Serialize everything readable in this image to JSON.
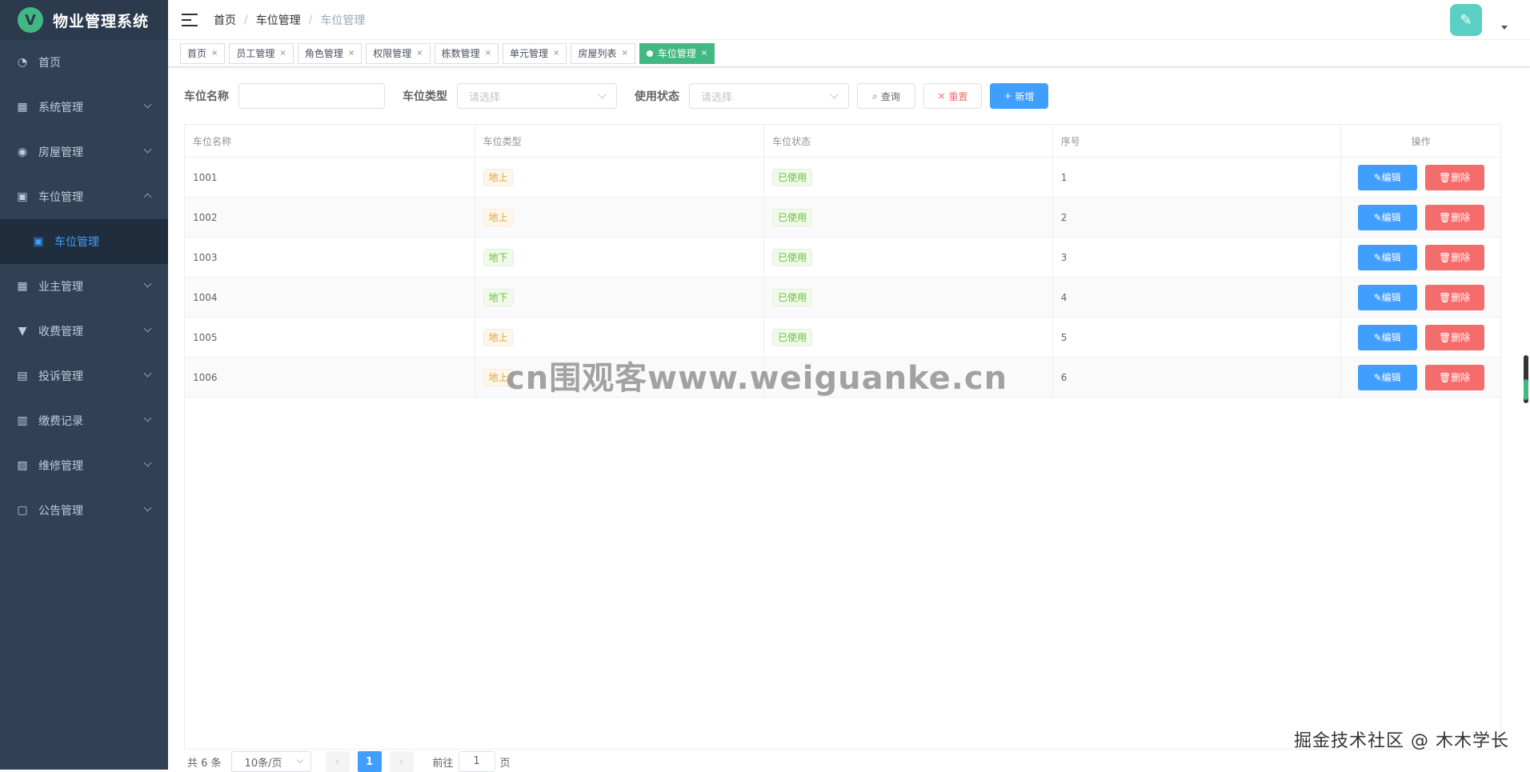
{
  "app": {
    "title": "物业管理系统",
    "logo_letter": "V"
  },
  "sidebar": {
    "items": [
      {
        "label": "首页",
        "icon": "dashboard-icon"
      },
      {
        "label": "系统管理",
        "icon": "grid-icon"
      },
      {
        "label": "房屋管理",
        "icon": "house-icon"
      },
      {
        "label": "车位管理",
        "icon": "parking-icon",
        "expanded": true,
        "children": [
          {
            "label": "车位管理",
            "icon": "parking-icon",
            "active": true
          }
        ]
      },
      {
        "label": "业主管理",
        "icon": "table-icon"
      },
      {
        "label": "收费管理",
        "icon": "payment-icon"
      },
      {
        "label": "投诉管理",
        "icon": "calendar-icon"
      },
      {
        "label": "缴费记录",
        "icon": "barcode-icon"
      },
      {
        "label": "维修管理",
        "icon": "image-icon"
      },
      {
        "label": "公告管理",
        "icon": "document-icon"
      }
    ]
  },
  "breadcrumb": [
    "首页",
    "车位管理",
    "车位管理"
  ],
  "tags": [
    {
      "label": "首页",
      "active": false
    },
    {
      "label": "员工管理",
      "active": false
    },
    {
      "label": "角色管理",
      "active": false
    },
    {
      "label": "权限管理",
      "active": false
    },
    {
      "label": "栋数管理",
      "active": false
    },
    {
      "label": "单元管理",
      "active": false
    },
    {
      "label": "房屋列表",
      "active": false
    },
    {
      "label": "车位管理",
      "active": true
    }
  ],
  "search": {
    "name_label": "车位名称",
    "name_value": "",
    "type_label": "车位类型",
    "type_placeholder": "请选择",
    "status_label": "使用状态",
    "status_placeholder": "请选择",
    "query_label": "查询",
    "reset_label": "重置",
    "add_label": "新增"
  },
  "table": {
    "columns": [
      "车位名称",
      "车位类型",
      "车位状态",
      "序号",
      "操作"
    ],
    "rows": [
      {
        "name": "1001",
        "type": "地上",
        "type_style": "warn",
        "status": "已使用",
        "order": "1"
      },
      {
        "name": "1002",
        "type": "地上",
        "type_style": "warn",
        "status": "已使用",
        "order": "2"
      },
      {
        "name": "1003",
        "type": "地下",
        "type_style": "succ",
        "status": "已使用",
        "order": "3"
      },
      {
        "name": "1004",
        "type": "地下",
        "type_style": "succ",
        "status": "已使用",
        "order": "4"
      },
      {
        "name": "1005",
        "type": "地上",
        "type_style": "warn",
        "status": "已使用",
        "order": "5"
      },
      {
        "name": "1006",
        "type": "地上",
        "type_style": "warn",
        "status": "",
        "order": "6"
      }
    ],
    "edit_label": "编辑",
    "delete_label": "删除"
  },
  "pagination": {
    "total_text": "共 6 条",
    "page_size": "10条/页",
    "current_page": "1",
    "goto_prefix": "前往",
    "goto_value": "1",
    "goto_suffix": "页"
  },
  "watermarks": {
    "overlay": "cn围观客www.weiguanke.cn",
    "corner": "掘金技术社区 @ 木木学长"
  },
  "colors": {
    "sidebar_bg": "#304156",
    "primary": "#409eff",
    "danger": "#f56c6c",
    "tag_active": "#42b983"
  }
}
